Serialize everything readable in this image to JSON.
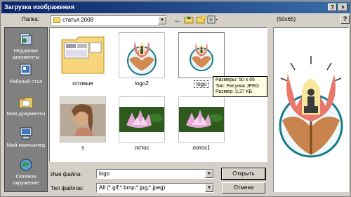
{
  "window": {
    "title": "Загрузка изображения",
    "help": "?",
    "close": "×"
  },
  "toolbar": {
    "lookin_label": "Папка:",
    "lookin_value": "статья 2008"
  },
  "places": [
    {
      "label": "Недавние документы",
      "icon": "recent-docs-icon"
    },
    {
      "label": "Рабочий стол",
      "icon": "desktop-icon"
    },
    {
      "label": "Мои документы",
      "icon": "my-documents-icon"
    },
    {
      "label": "Мой компьютер",
      "icon": "my-computer-icon"
    },
    {
      "label": "Сетевое окружение",
      "icon": "network-icon"
    }
  ],
  "files": [
    {
      "name": "готовые",
      "type": "folder"
    },
    {
      "name": "logo2",
      "type": "logo"
    },
    {
      "name": "logo",
      "type": "logo",
      "selected": true
    },
    {
      "name": "s",
      "type": "photo"
    },
    {
      "name": "лотос",
      "type": "lotus"
    },
    {
      "name": "лотос1",
      "type": "lotus"
    }
  ],
  "tooltip": {
    "line1": "Размеры: 50 x 65",
    "line2": "Тип: Рисунок JPEG",
    "line3": "Размер: 3,37 КБ"
  },
  "preview": {
    "size_label": "(50x65)"
  },
  "form": {
    "filename_label": "Имя файла:",
    "filename_value": "logo",
    "filetype_label": "Тип файлов:",
    "filetype_value": "All (*.gif;*.bmp;*.jpg;*.jpeg)",
    "open_button": "Открыть",
    "cancel_button": "Отмена"
  }
}
